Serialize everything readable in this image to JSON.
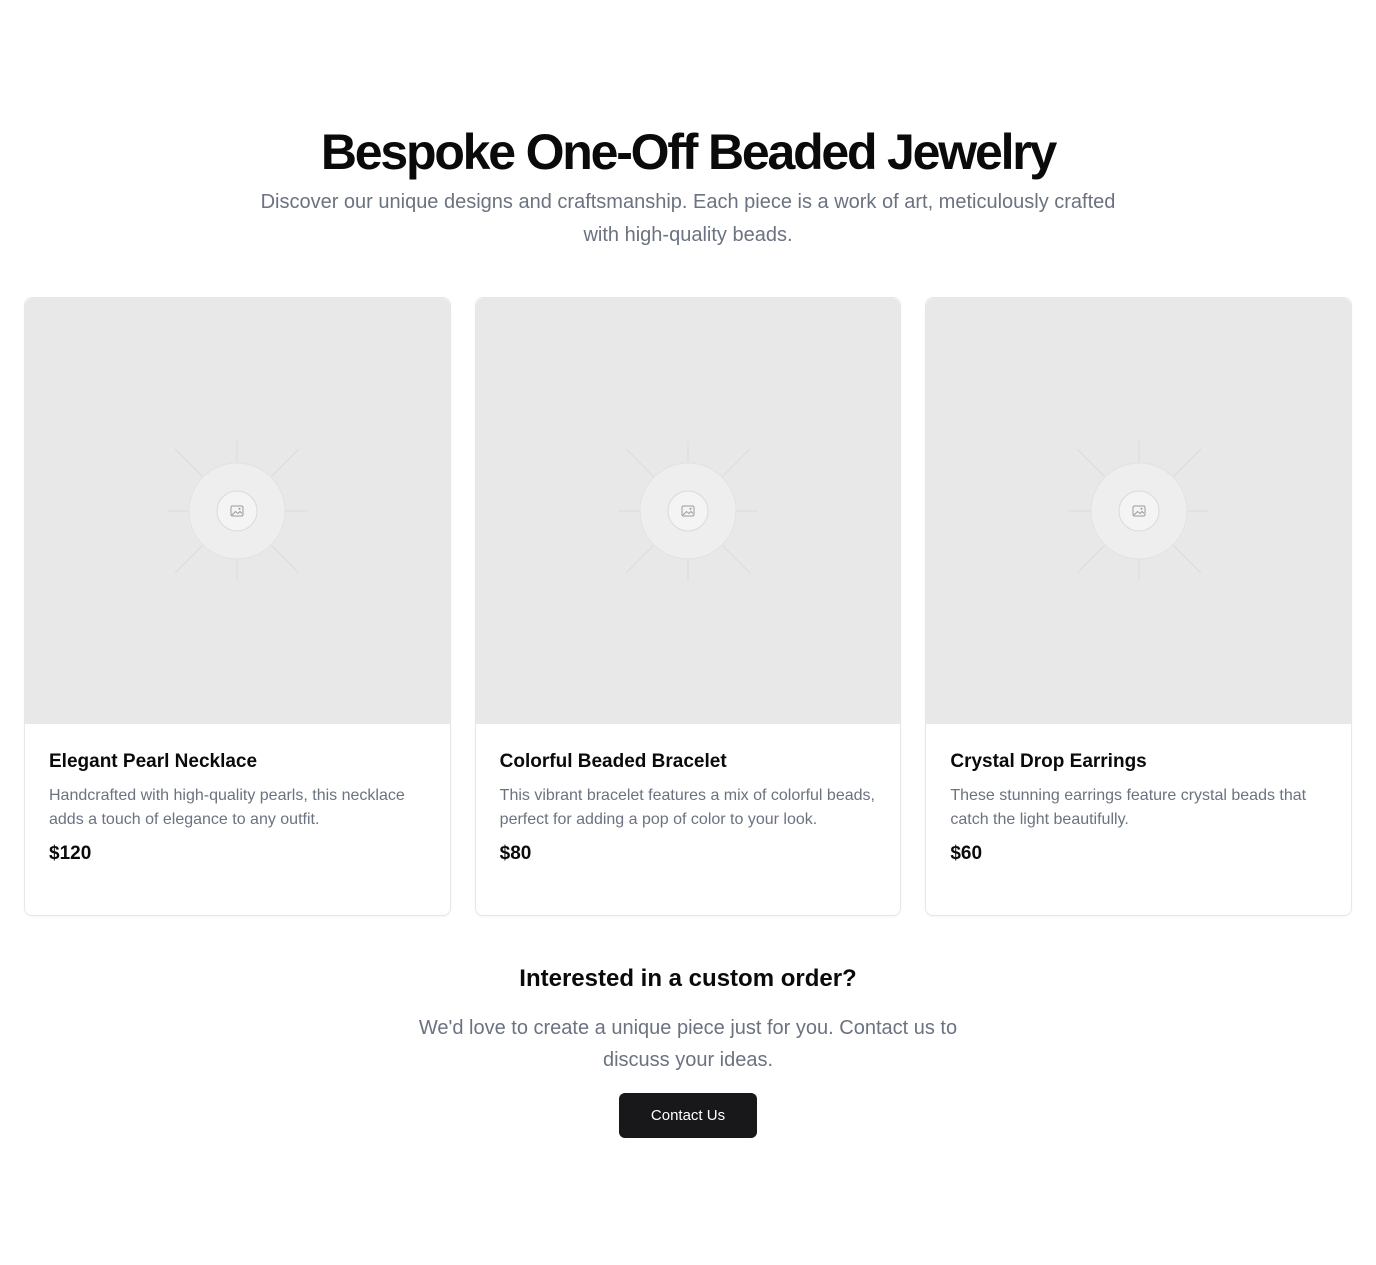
{
  "hero": {
    "title": "Bespoke One-Off Beaded Jewelry",
    "subtitle": "Discover our unique designs and craftsmanship. Each piece is a work of art, meticulously crafted with high-quality beads."
  },
  "products": [
    {
      "title": "Elegant Pearl Necklace",
      "description": "Handcrafted with high-quality pearls, this necklace adds a touch of elegance to any outfit.",
      "price": "$120",
      "image_icon": "image-placeholder-icon"
    },
    {
      "title": "Colorful Beaded Bracelet",
      "description": "This vibrant bracelet features a mix of colorful beads, perfect for adding a pop of color to your look.",
      "price": "$80",
      "image_icon": "image-placeholder-icon"
    },
    {
      "title": "Crystal Drop Earrings",
      "description": "These stunning earrings feature crystal beads that catch the light beautifully.",
      "price": "$60",
      "image_icon": "image-placeholder-icon"
    }
  ],
  "cta": {
    "heading": "Interested in a custom order?",
    "text": "We'd love to create a unique piece just for you. Contact us to discuss your ideas.",
    "button_label": "Contact Us"
  },
  "colors": {
    "heading": "#0a0a0a",
    "muted_text": "#6b7280",
    "image_placeholder_bg": "#e8e8e8",
    "button_bg": "#18181b",
    "button_text": "#ffffff",
    "card_border": "#e5e7eb"
  }
}
